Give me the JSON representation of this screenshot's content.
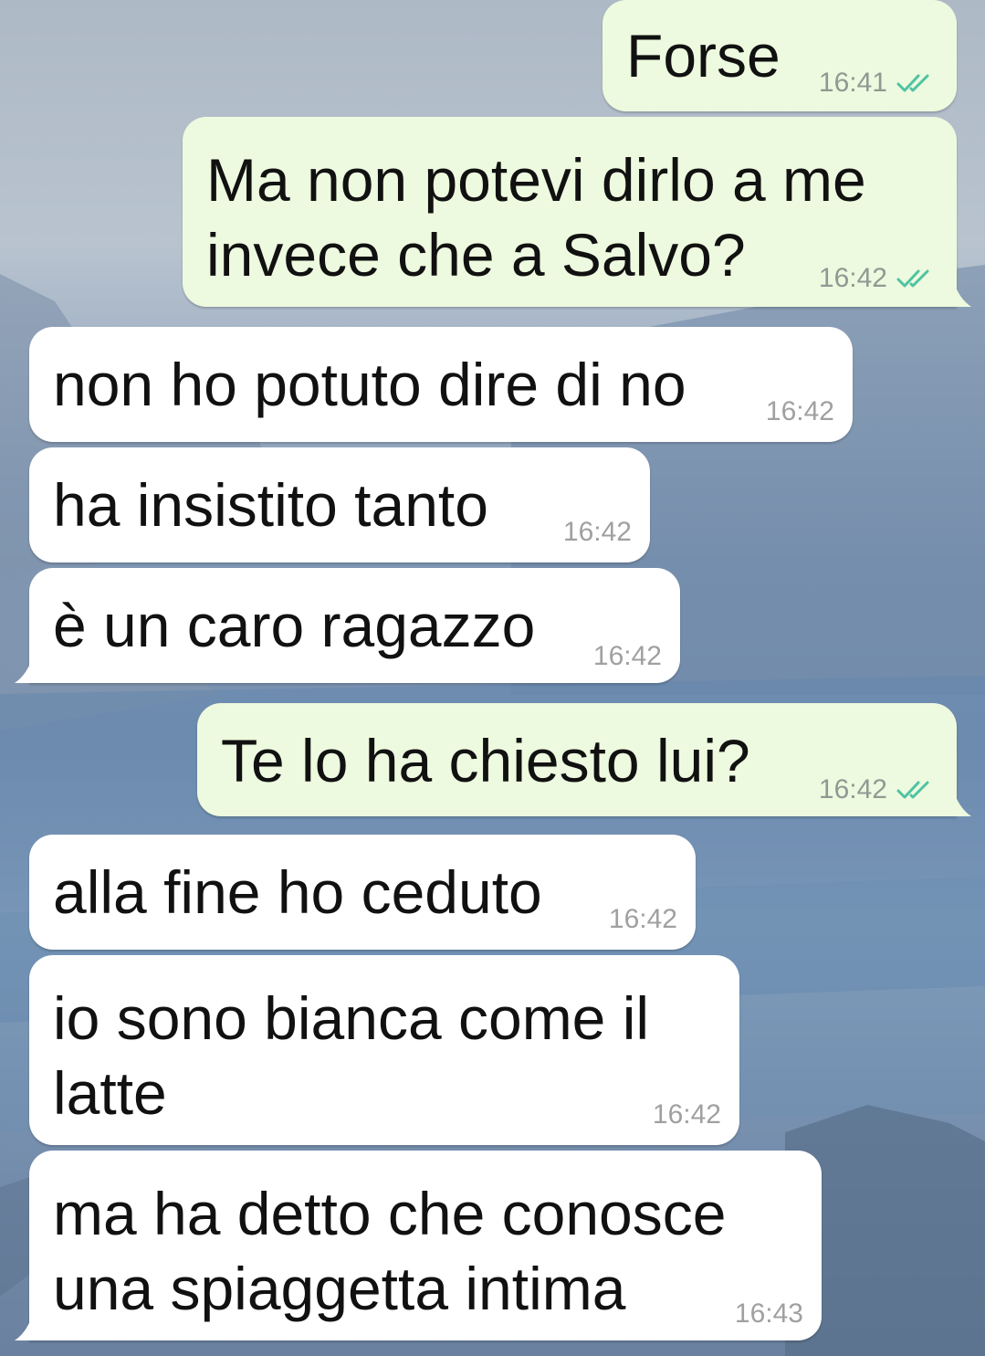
{
  "conversation": {
    "messages": [
      {
        "direction": "out",
        "lines": [
          "Forse"
        ],
        "time": "16:41",
        "status": "read",
        "status_icon": "double-check-icon"
      },
      {
        "direction": "out",
        "lines": [
          "Ma non potevi dirlo a me",
          "invece che a Salvo?"
        ],
        "time": "16:42",
        "status": "read",
        "status_icon": "double-check-icon"
      },
      {
        "direction": "in",
        "lines": [
          "non ho potuto dire di no"
        ],
        "time": "16:42"
      },
      {
        "direction": "in",
        "lines": [
          "ha insistito tanto"
        ],
        "time": "16:42"
      },
      {
        "direction": "in",
        "lines": [
          "è un caro ragazzo"
        ],
        "time": "16:42"
      },
      {
        "direction": "out",
        "lines": [
          "Te lo ha chiesto lui?"
        ],
        "time": "16:42",
        "status": "read",
        "status_icon": "double-check-icon"
      },
      {
        "direction": "in",
        "lines": [
          "alla fine ho ceduto"
        ],
        "time": "16:42"
      },
      {
        "direction": "in",
        "lines": [
          "io sono bianca come il",
          "latte"
        ],
        "time": "16:42"
      },
      {
        "direction": "in",
        "lines": [
          "ma ha detto che conosce",
          "una spiaggetta intima"
        ],
        "time": "16:43"
      }
    ]
  },
  "colors": {
    "outgoing_bubble": "#edfadf",
    "incoming_bubble": "#ffffff",
    "read_tick": "#4fc3a1",
    "timestamp_out": "#8e9a92",
    "timestamp_in": "#a0a0a0"
  }
}
